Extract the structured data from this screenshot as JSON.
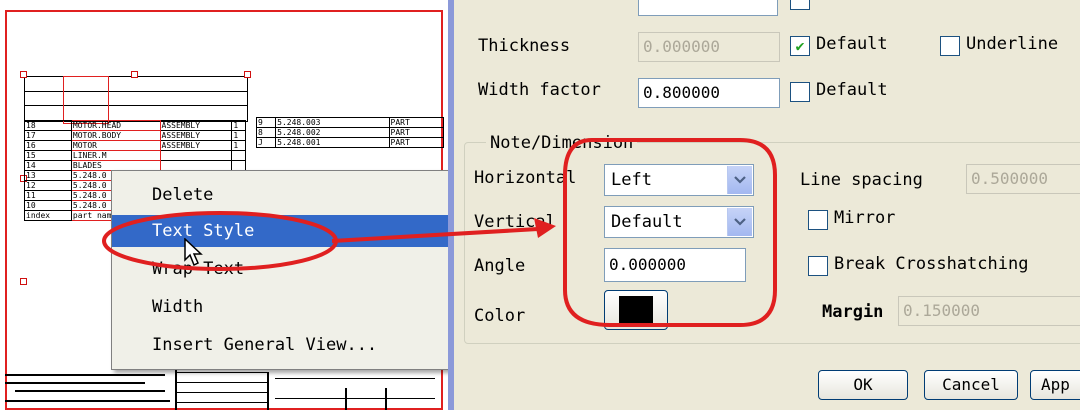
{
  "drawing": {
    "bom_rows": [
      [
        "18",
        "MOTOR.HEAD",
        "ASSEMBLY",
        "1"
      ],
      [
        "17",
        "MOTOR.BODY",
        "ASSEMBLY",
        "1"
      ],
      [
        "16",
        "MOTOR",
        "ASSEMBLY",
        "1"
      ],
      [
        "15",
        "LINER.M",
        "",
        " "
      ],
      [
        "14",
        "BLADES",
        "",
        ""
      ],
      [
        "13",
        "5.248.0",
        "",
        ""
      ],
      [
        "12",
        "5.248.0",
        "",
        ""
      ],
      [
        "11",
        "5.248.0",
        "",
        ""
      ],
      [
        "10",
        "5.248.0",
        "",
        ""
      ],
      [
        "index",
        "part name",
        "",
        ""
      ]
    ],
    "bom_rows_right": [
      [
        "9",
        "5.248.003",
        "PART"
      ],
      [
        "8",
        "5.248.002",
        "PART"
      ],
      [
        "J",
        "5.248.001",
        "PART"
      ]
    ]
  },
  "context_menu": {
    "items": [
      "Delete",
      "Text Style",
      "Wrap Text",
      "Width",
      "Insert General View..."
    ],
    "selected": "Text Style"
  },
  "dialog": {
    "thickness": {
      "label": "Thickness",
      "value": "0.000000",
      "default_label": "Default",
      "default_checked": true,
      "underline_label": "Underline"
    },
    "width_factor": {
      "label": "Width factor",
      "value": "0.800000",
      "default_label": "Default",
      "default_checked": false
    },
    "note_dimension": {
      "title": "Note/Dimension",
      "horizontal": {
        "label": "Horizontal",
        "value": "Left"
      },
      "vertical": {
        "label": "Vertical",
        "value": "Default"
      },
      "angle": {
        "label": "Angle",
        "value": "0.000000"
      },
      "color": {
        "label": "Color",
        "swatch": "#000000"
      },
      "line_spacing": {
        "label": "Line spacing",
        "value": "0.500000"
      },
      "mirror_label": "Mirror",
      "break_crosshatching_label": "Break Crosshatching",
      "margin": {
        "label": "Margin",
        "value": "0.150000"
      }
    },
    "buttons": {
      "ok": "OK",
      "cancel": "Cancel",
      "apply": "App"
    }
  },
  "annotation_color": "#e02020"
}
